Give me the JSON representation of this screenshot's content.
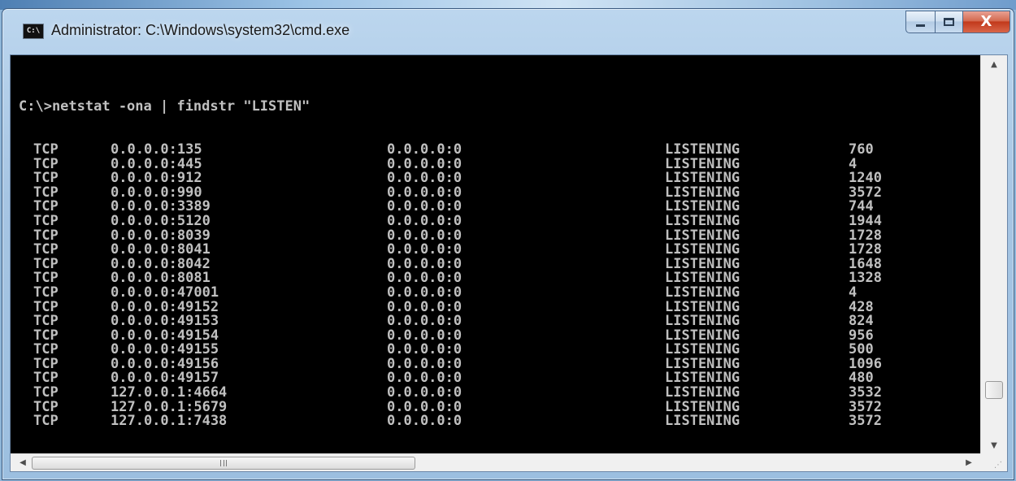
{
  "window": {
    "title": "Administrator: C:\\Windows\\system32\\cmd.exe",
    "icon_label": "C:\\",
    "minimize_icon": "minimize-icon",
    "maximize_icon": "maximize-icon",
    "close_icon": "close-icon",
    "close_glyph": "X"
  },
  "console": {
    "command": "C:\\>netstat -ona | findstr \"LISTEN\"",
    "rows": [
      {
        "proto": "TCP",
        "local": "0.0.0.0:135",
        "foreign": "0.0.0.0:0",
        "state": "LISTENING",
        "pid": "760"
      },
      {
        "proto": "TCP",
        "local": "0.0.0.0:445",
        "foreign": "0.0.0.0:0",
        "state": "LISTENING",
        "pid": "4"
      },
      {
        "proto": "TCP",
        "local": "0.0.0.0:912",
        "foreign": "0.0.0.0:0",
        "state": "LISTENING",
        "pid": "1240"
      },
      {
        "proto": "TCP",
        "local": "0.0.0.0:990",
        "foreign": "0.0.0.0:0",
        "state": "LISTENING",
        "pid": "3572"
      },
      {
        "proto": "TCP",
        "local": "0.0.0.0:3389",
        "foreign": "0.0.0.0:0",
        "state": "LISTENING",
        "pid": "744"
      },
      {
        "proto": "TCP",
        "local": "0.0.0.0:5120",
        "foreign": "0.0.0.0:0",
        "state": "LISTENING",
        "pid": "1944"
      },
      {
        "proto": "TCP",
        "local": "0.0.0.0:8039",
        "foreign": "0.0.0.0:0",
        "state": "LISTENING",
        "pid": "1728"
      },
      {
        "proto": "TCP",
        "local": "0.0.0.0:8041",
        "foreign": "0.0.0.0:0",
        "state": "LISTENING",
        "pid": "1728"
      },
      {
        "proto": "TCP",
        "local": "0.0.0.0:8042",
        "foreign": "0.0.0.0:0",
        "state": "LISTENING",
        "pid": "1648"
      },
      {
        "proto": "TCP",
        "local": "0.0.0.0:8081",
        "foreign": "0.0.0.0:0",
        "state": "LISTENING",
        "pid": "1328"
      },
      {
        "proto": "TCP",
        "local": "0.0.0.0:47001",
        "foreign": "0.0.0.0:0",
        "state": "LISTENING",
        "pid": "4"
      },
      {
        "proto": "TCP",
        "local": "0.0.0.0:49152",
        "foreign": "0.0.0.0:0",
        "state": "LISTENING",
        "pid": "428"
      },
      {
        "proto": "TCP",
        "local": "0.0.0.0:49153",
        "foreign": "0.0.0.0:0",
        "state": "LISTENING",
        "pid": "824"
      },
      {
        "proto": "TCP",
        "local": "0.0.0.0:49154",
        "foreign": "0.0.0.0:0",
        "state": "LISTENING",
        "pid": "956"
      },
      {
        "proto": "TCP",
        "local": "0.0.0.0:49155",
        "foreign": "0.0.0.0:0",
        "state": "LISTENING",
        "pid": "500"
      },
      {
        "proto": "TCP",
        "local": "0.0.0.0:49156",
        "foreign": "0.0.0.0:0",
        "state": "LISTENING",
        "pid": "1096"
      },
      {
        "proto": "TCP",
        "local": "0.0.0.0:49157",
        "foreign": "0.0.0.0:0",
        "state": "LISTENING",
        "pid": "480"
      },
      {
        "proto": "TCP",
        "local": "127.0.0.1:4664",
        "foreign": "0.0.0.0:0",
        "state": "LISTENING",
        "pid": "3532"
      },
      {
        "proto": "TCP",
        "local": "127.0.0.1:5679",
        "foreign": "0.0.0.0:0",
        "state": "LISTENING",
        "pid": "3572"
      },
      {
        "proto": "TCP",
        "local": "127.0.0.1:7438",
        "foreign": "0.0.0.0:0",
        "state": "LISTENING",
        "pid": "3572"
      }
    ],
    "background_color": "#000000",
    "text_color": "#c0c0c0"
  },
  "scrollbars": {
    "up_arrow": "▲",
    "down_arrow": "▼",
    "left_arrow": "◀",
    "right_arrow": "▶",
    "grip_label": "III"
  }
}
